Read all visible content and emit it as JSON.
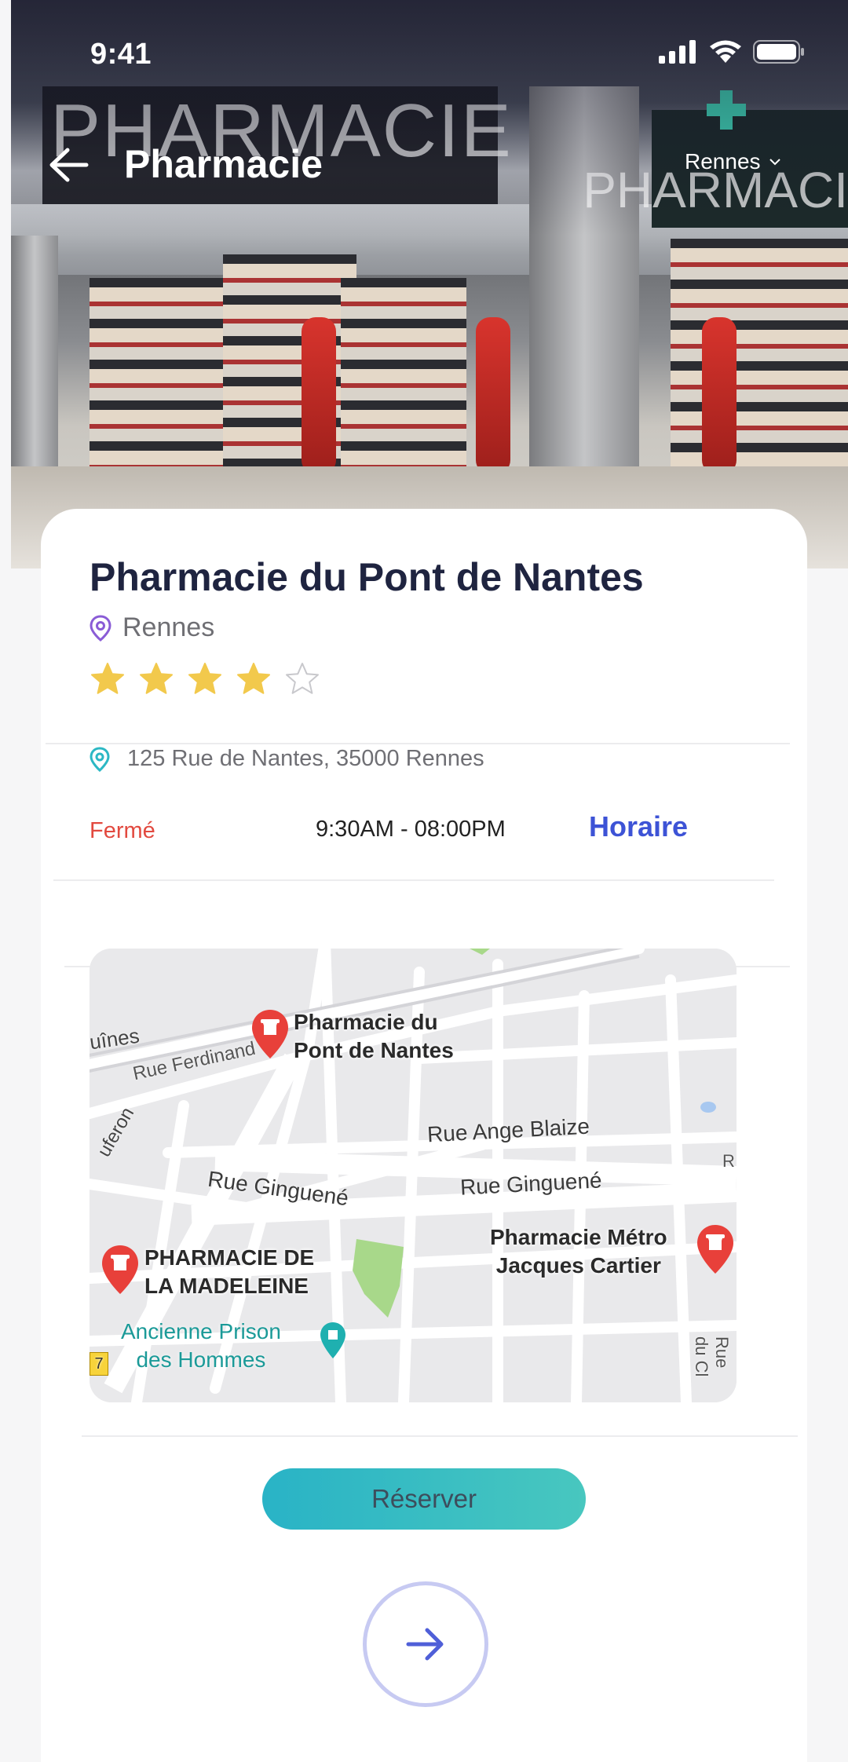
{
  "status_bar": {
    "time": "9:41"
  },
  "header": {
    "title": "Pharmacie",
    "city": "Rennes"
  },
  "pharmacy": {
    "name": "Pharmacie du Pont de Nantes",
    "city": "Rennes",
    "rating": 4,
    "rating_max": 5,
    "address": "125 Rue de Nantes, 35000 Rennes",
    "state": "Fermé",
    "hours": "9:30AM - 08:00PM",
    "hours_link": "Horaire"
  },
  "map": {
    "places": {
      "p1": "Pharmacie du\nPont de Nantes",
      "p2": "PHARMACIE DE\nLA MADELEINE",
      "p3": "Pharmacie Métro\nJacques Cartier",
      "p4": "Ancienne Prison\ndes Hommes"
    },
    "streets": {
      "s1": "Rue Ferdinand",
      "s2": "Rue Ange Blaize",
      "s3": "Rue Ginguené",
      "s4": "Rue Ginguené",
      "s5": "Rue du Cl",
      "s6": "uînes",
      "s7": "uferon",
      "s8": "R",
      "s9": "7"
    }
  },
  "actions": {
    "reserve": "Réserver"
  },
  "colors": {
    "accent": "#3d53d6",
    "closed": "#e2493f",
    "button_start": "#29b3c6",
    "button_end": "#48c7bf",
    "star": "#f2c94c"
  }
}
